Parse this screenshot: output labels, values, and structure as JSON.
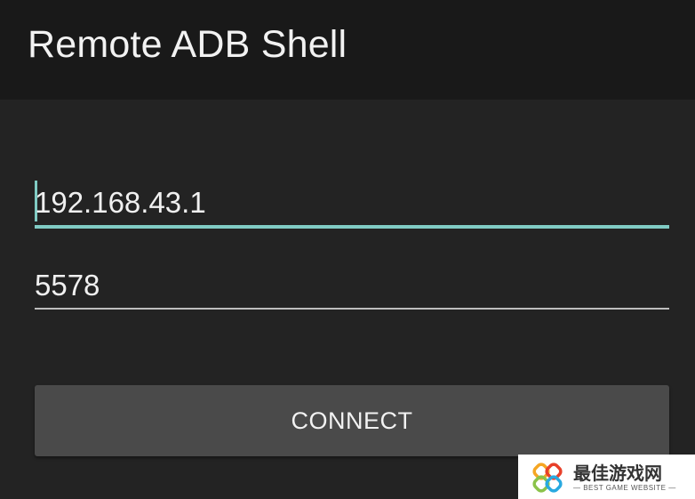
{
  "app_bar": {
    "title": "Remote ADB Shell"
  },
  "form": {
    "host": {
      "value": "192.168.43.1",
      "focused": true
    },
    "port": {
      "value": "5578"
    },
    "connect_label": "CONNECT"
  },
  "colors": {
    "app_bar_bg": "#191919",
    "content_bg": "#232323",
    "accent": "#80cbc4",
    "button_bg": "#4a4a4a",
    "text": "#f0f0f0"
  },
  "watermark": {
    "chinese_text": "最佳游戏网",
    "english_text": "— BEST GAME WEBSITE —",
    "logo_icon": "interlaced-rings-logo"
  }
}
